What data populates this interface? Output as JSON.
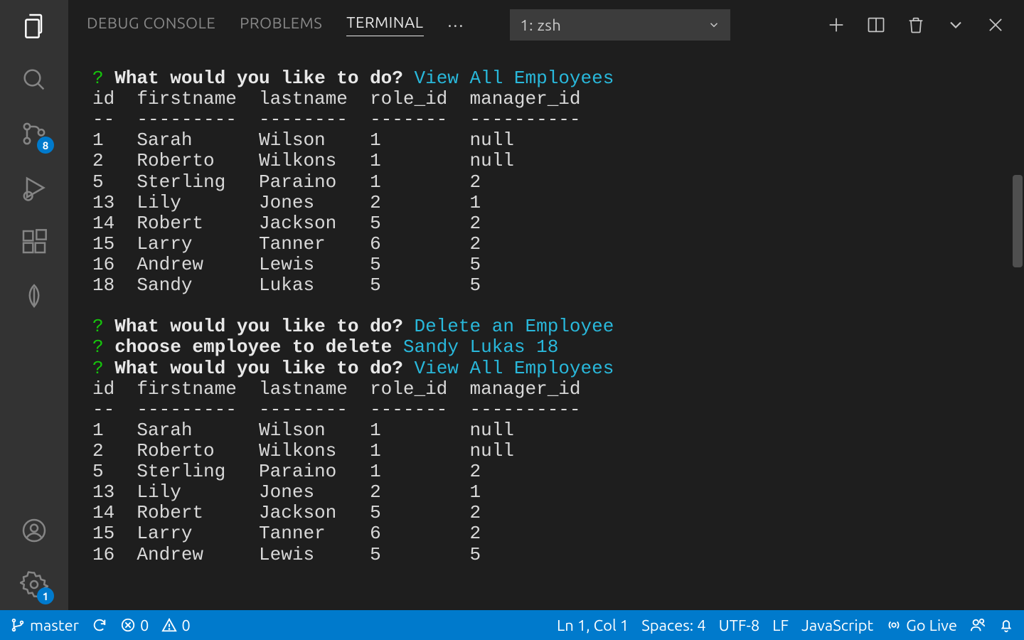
{
  "activitybar": {
    "scm_badge": "8",
    "settings_badge": "1"
  },
  "panel": {
    "tabs": {
      "debug_console": "DEBUG CONSOLE",
      "problems": "PROBLEMS",
      "terminal": "TERMINAL"
    },
    "terminal_selector": "1: zsh"
  },
  "terminal": {
    "prompt1_q": "?",
    "prompt1_text": "What would you like to do?",
    "prompt1_answer": "View All Employees",
    "headers": {
      "id": "id",
      "firstname": "firstname",
      "lastname": "lastname",
      "role_id": "role_id",
      "manager_id": "manager_id"
    },
    "divider": {
      "id": "--",
      "firstname": "---------",
      "lastname": "--------",
      "role_id": "-------",
      "manager_id": "----------"
    },
    "table1": [
      {
        "id": "1",
        "firstname": "Sarah",
        "lastname": "Wilson",
        "role_id": "1",
        "manager_id": "null"
      },
      {
        "id": "2",
        "firstname": "Roberto",
        "lastname": "Wilkons",
        "role_id": "1",
        "manager_id": "null"
      },
      {
        "id": "5",
        "firstname": "Sterling",
        "lastname": "Paraino",
        "role_id": "1",
        "manager_id": "2"
      },
      {
        "id": "13",
        "firstname": "Lily",
        "lastname": "Jones",
        "role_id": "2",
        "manager_id": "1"
      },
      {
        "id": "14",
        "firstname": "Robert",
        "lastname": "Jackson",
        "role_id": "5",
        "manager_id": "2"
      },
      {
        "id": "15",
        "firstname": "Larry",
        "lastname": "Tanner",
        "role_id": "6",
        "manager_id": "2"
      },
      {
        "id": "16",
        "firstname": "Andrew",
        "lastname": "Lewis",
        "role_id": "5",
        "manager_id": "5"
      },
      {
        "id": "18",
        "firstname": "Sandy",
        "lastname": "Lukas",
        "role_id": "5",
        "manager_id": "5"
      }
    ],
    "prompt2_q": "?",
    "prompt2_text": "What would you like to do?",
    "prompt2_answer": "Delete an Employee",
    "prompt3_q": "?",
    "prompt3_text": "choose employee to delete",
    "prompt3_answer": "Sandy Lukas 18",
    "prompt4_q": "?",
    "prompt4_text": "What would you like to do?",
    "prompt4_answer": "View All Employees",
    "table2": [
      {
        "id": "1",
        "firstname": "Sarah",
        "lastname": "Wilson",
        "role_id": "1",
        "manager_id": "null"
      },
      {
        "id": "2",
        "firstname": "Roberto",
        "lastname": "Wilkons",
        "role_id": "1",
        "manager_id": "null"
      },
      {
        "id": "5",
        "firstname": "Sterling",
        "lastname": "Paraino",
        "role_id": "1",
        "manager_id": "2"
      },
      {
        "id": "13",
        "firstname": "Lily",
        "lastname": "Jones",
        "role_id": "2",
        "manager_id": "1"
      },
      {
        "id": "14",
        "firstname": "Robert",
        "lastname": "Jackson",
        "role_id": "5",
        "manager_id": "2"
      },
      {
        "id": "15",
        "firstname": "Larry",
        "lastname": "Tanner",
        "role_id": "6",
        "manager_id": "2"
      },
      {
        "id": "16",
        "firstname": "Andrew",
        "lastname": "Lewis",
        "role_id": "5",
        "manager_id": "5"
      }
    ]
  },
  "statusbar": {
    "branch": "master",
    "errors": "0",
    "warnings": "0",
    "cursor": "Ln 1, Col 1",
    "spaces": "Spaces: 4",
    "encoding": "UTF-8",
    "eol": "LF",
    "lang": "JavaScript",
    "golive": "Go Live"
  }
}
